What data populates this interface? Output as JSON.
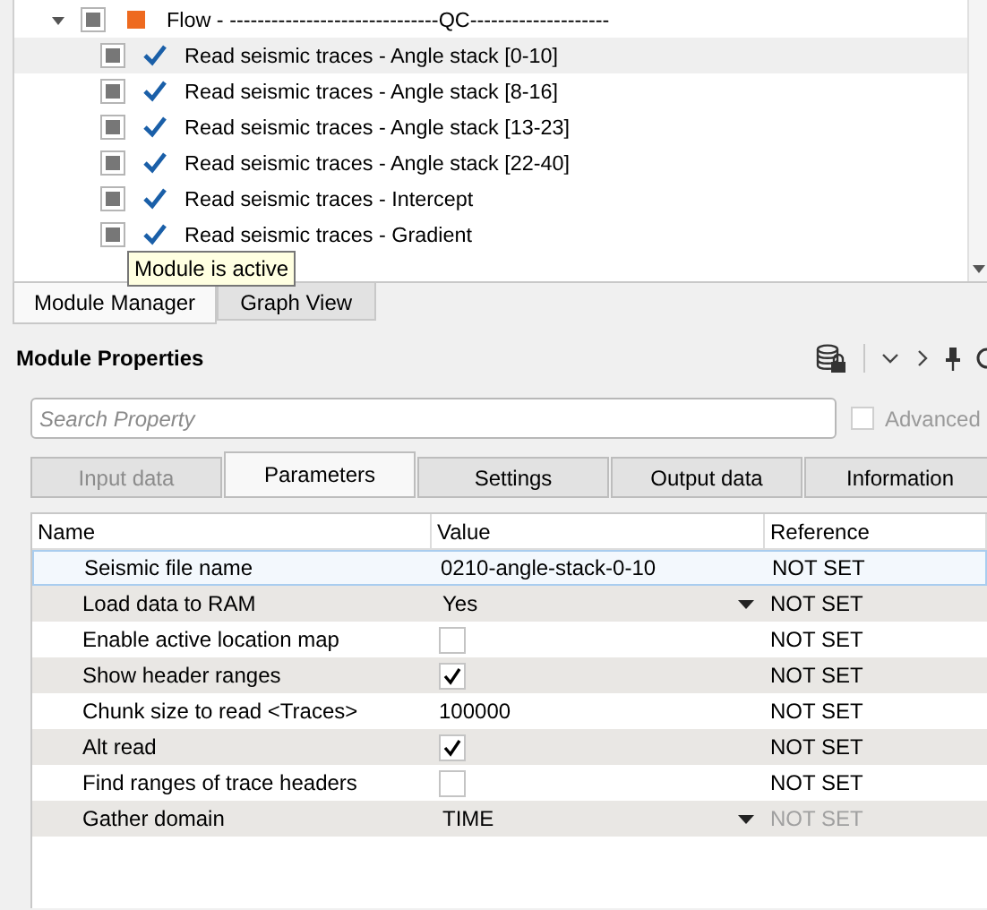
{
  "tree": {
    "root": {
      "label": "Flow - ------------------------------QC--------------------",
      "expanded": true,
      "children": [
        {
          "label": "Read seismic traces - Angle stack [0-10]",
          "selected": true
        },
        {
          "label": "Read seismic traces - Angle stack [8-16]",
          "selected": false
        },
        {
          "label": "Read seismic traces - Angle stack [13-23]",
          "selected": false
        },
        {
          "label": "Read seismic traces - Angle stack [22-40]",
          "selected": false
        },
        {
          "label": "Read seismic traces - Intercept",
          "selected": false
        },
        {
          "label": "Read seismic traces - Gradient",
          "selected": false
        }
      ]
    }
  },
  "tooltip": "Module is active",
  "bottom_tabs": [
    {
      "label": "Module Manager",
      "selected": true
    },
    {
      "label": "Graph View",
      "selected": false
    }
  ],
  "properties": {
    "title": "Module Properties",
    "search": {
      "placeholder": "Search Property"
    },
    "advanced": {
      "label": "Advanced",
      "checked": false,
      "disabled": true
    },
    "tabs": [
      {
        "label": "Input data",
        "selected": false,
        "disabled": true
      },
      {
        "label": "Parameters",
        "selected": true,
        "disabled": false
      },
      {
        "label": "Settings",
        "selected": false,
        "disabled": false
      },
      {
        "label": "Output data",
        "selected": false,
        "disabled": false
      },
      {
        "label": "Information",
        "selected": false,
        "disabled": false
      }
    ],
    "columns": [
      "Name",
      "Value",
      "Reference"
    ],
    "rows": [
      {
        "name": "Seismic file name",
        "kind": "text",
        "value": "0210-angle-stack-0-10",
        "reference": "NOT SET",
        "selected": true,
        "reference_disabled": false
      },
      {
        "name": "Load data to RAM",
        "kind": "dropdown",
        "value": "Yes",
        "reference": "NOT SET",
        "selected": false,
        "reference_disabled": false
      },
      {
        "name": "Enable active location map",
        "kind": "checkbox",
        "checked": false,
        "reference": "NOT SET",
        "selected": false,
        "reference_disabled": false
      },
      {
        "name": "Show header ranges",
        "kind": "checkbox",
        "checked": true,
        "reference": "NOT SET",
        "selected": false,
        "reference_disabled": false
      },
      {
        "name": "Chunk size to read <Traces>",
        "kind": "text",
        "value": "100000",
        "reference": "NOT SET",
        "selected": false,
        "reference_disabled": false
      },
      {
        "name": "Alt read",
        "kind": "checkbox",
        "checked": true,
        "reference": "NOT SET",
        "selected": false,
        "reference_disabled": false
      },
      {
        "name": "Find ranges of trace headers",
        "kind": "checkbox",
        "checked": false,
        "reference": "NOT SET",
        "selected": false,
        "reference_disabled": false
      },
      {
        "name": "Gather domain",
        "kind": "dropdown",
        "value": "TIME",
        "reference": "NOT SET",
        "selected": false,
        "reference_disabled": true
      }
    ]
  }
}
